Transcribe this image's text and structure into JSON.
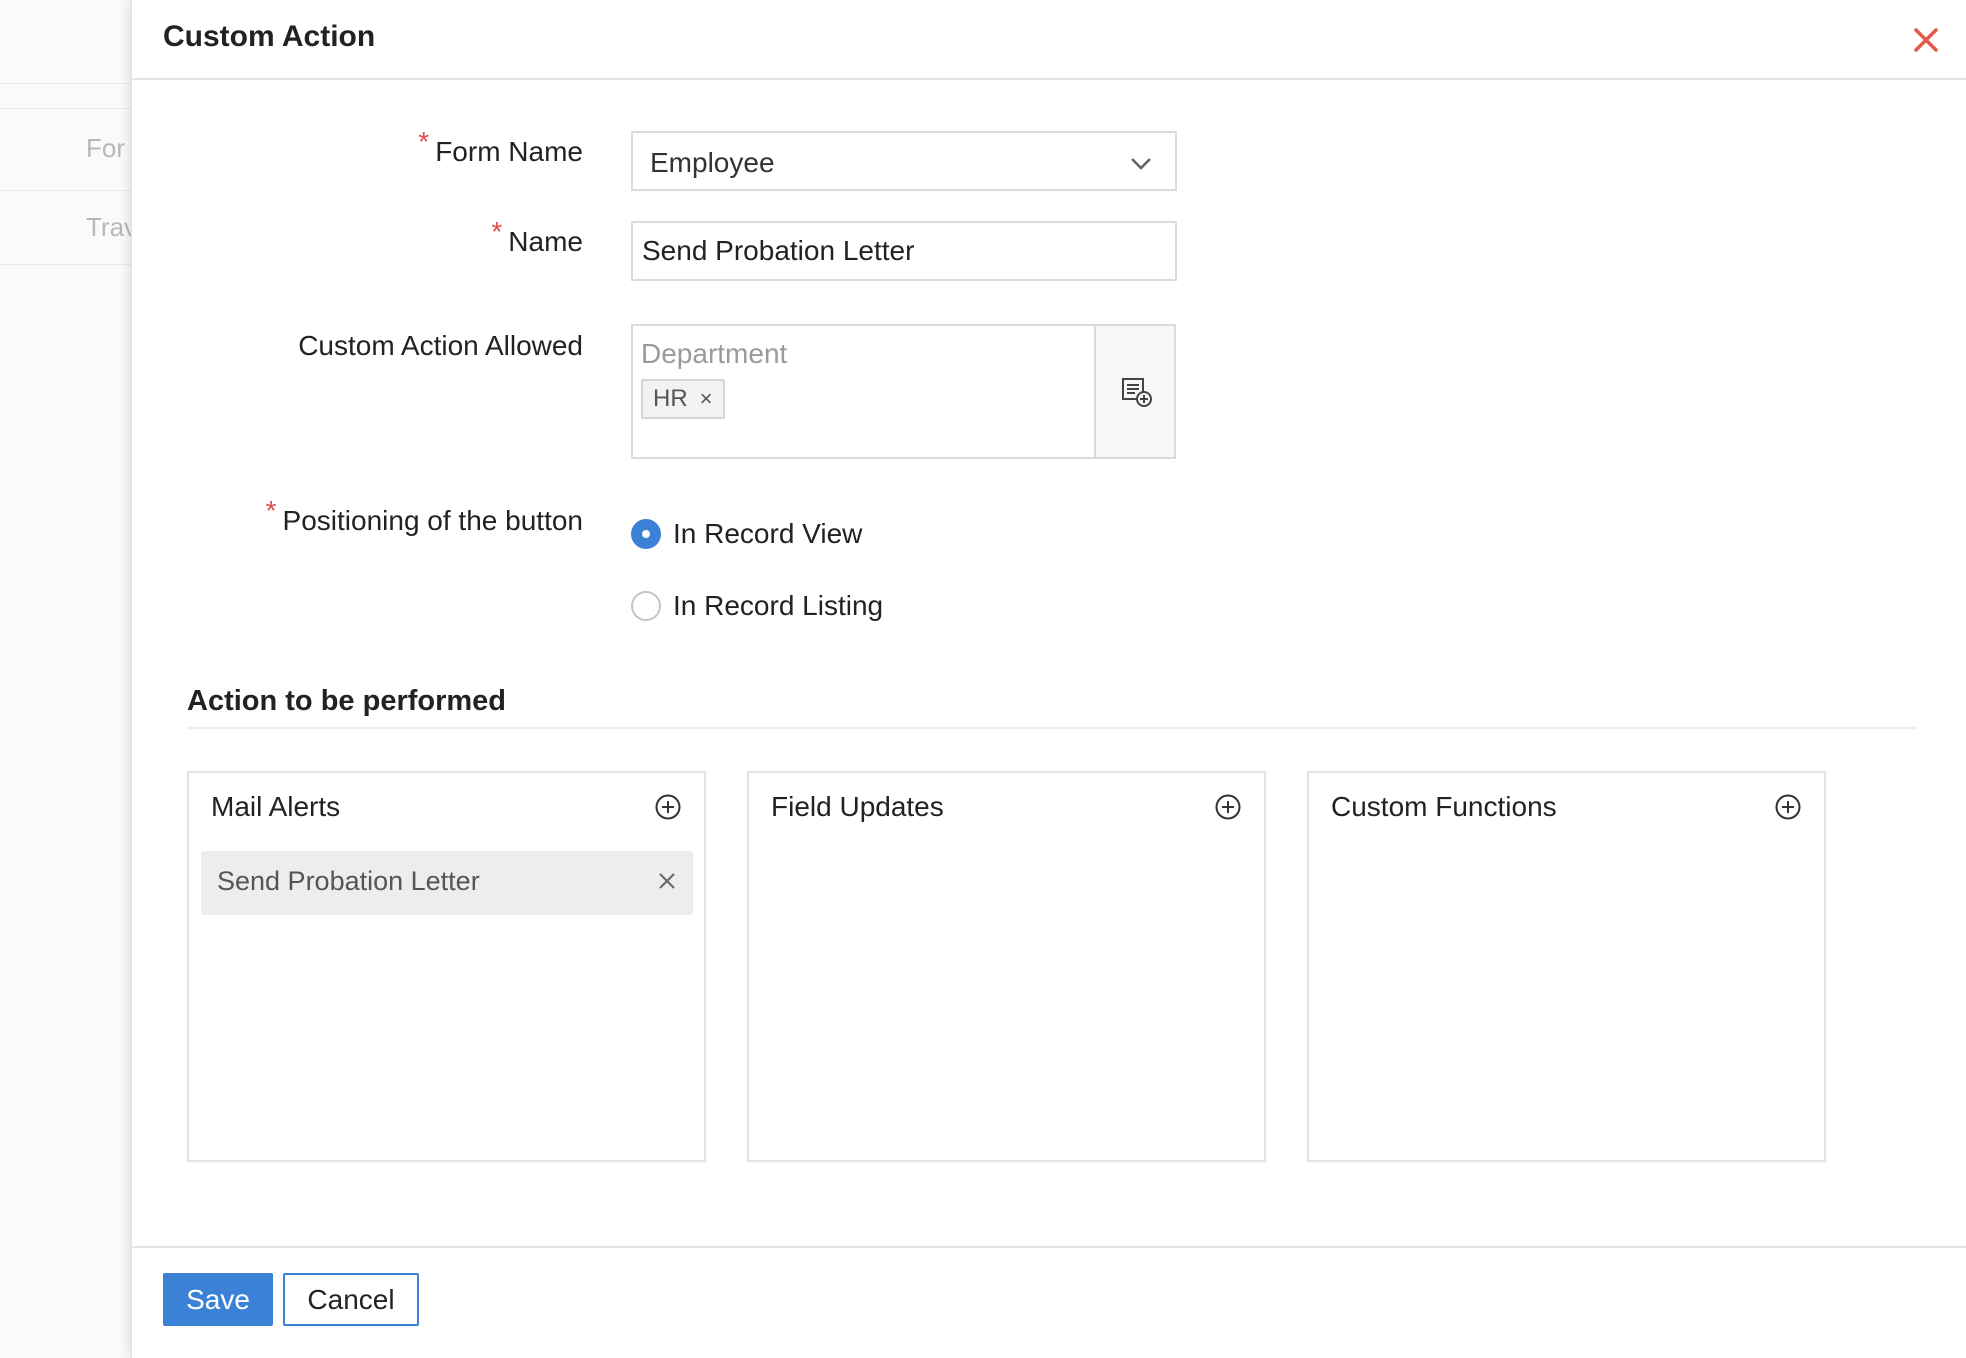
{
  "background": {
    "items": [
      "For",
      "Trav"
    ]
  },
  "dialog": {
    "title": "Custom Action"
  },
  "form": {
    "form_name": {
      "label": "Form Name",
      "required_mark": "*",
      "value": "Employee"
    },
    "name": {
      "label": "Name",
      "required_mark": "*",
      "value": "Send Probation Letter"
    },
    "custom_action_allowed": {
      "label": "Custom Action Allowed",
      "group_label": "Department",
      "tags": [
        {
          "label": "HR",
          "remove": "×"
        }
      ]
    },
    "positioning": {
      "label": "Positioning of the button",
      "required_mark": "*",
      "options": [
        {
          "label": "In Record View",
          "checked": true
        },
        {
          "label": "In Record Listing",
          "checked": false
        }
      ]
    }
  },
  "actions": {
    "section_title": "Action to be performed",
    "cards": [
      {
        "title": "Mail Alerts",
        "items": [
          {
            "label": "Send Probation Letter"
          }
        ]
      },
      {
        "title": "Field Updates",
        "items": []
      },
      {
        "title": "Custom Functions",
        "items": []
      }
    ]
  },
  "footer": {
    "save_label": "Save",
    "cancel_label": "Cancel"
  },
  "colors": {
    "accent": "#3b82d6",
    "required": "#e24b4b",
    "close": "#e4574d"
  }
}
